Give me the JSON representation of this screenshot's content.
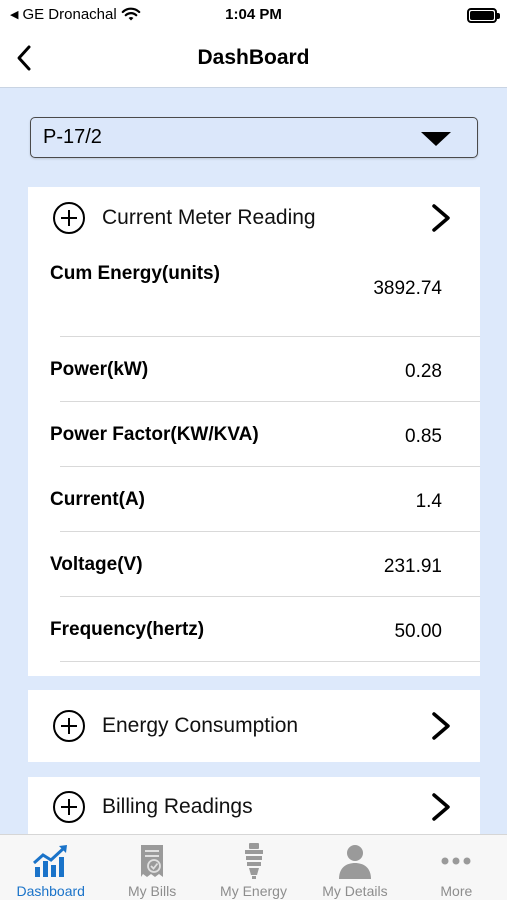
{
  "status_bar": {
    "carrier": "GE Dronachal",
    "time": "1:04 PM"
  },
  "nav": {
    "title": "DashBoard"
  },
  "meter_select": {
    "value": "P-17/2"
  },
  "current_meter": {
    "title": "Current Meter Reading",
    "readings": [
      {
        "label": "Cum Energy(units)",
        "value": "3892.74"
      },
      {
        "label": "Power(kW)",
        "value": "0.28"
      },
      {
        "label": "Power Factor(KW/KVA)",
        "value": "0.85"
      },
      {
        "label": "Current(A)",
        "value": "1.4"
      },
      {
        "label": "Voltage(V)",
        "value": "231.91"
      },
      {
        "label": "Frequency(hertz)",
        "value": "50.00"
      }
    ]
  },
  "energy_consumption": {
    "title": "Energy Consumption"
  },
  "billing_readings": {
    "title": "Billing Readings"
  },
  "tabs": [
    {
      "label": "Dashboard",
      "icon": "chart-icon",
      "active": true
    },
    {
      "label": "My Bills",
      "icon": "bill-icon",
      "active": false
    },
    {
      "label": "My Energy",
      "icon": "bulb-icon",
      "active": false
    },
    {
      "label": "My Details",
      "icon": "user-icon",
      "active": false
    },
    {
      "label": "More",
      "icon": "more-icon",
      "active": false
    }
  ],
  "colors": {
    "background": "#dde9fb",
    "accent": "#1a73c9",
    "inactive": "#8d8d8d"
  }
}
